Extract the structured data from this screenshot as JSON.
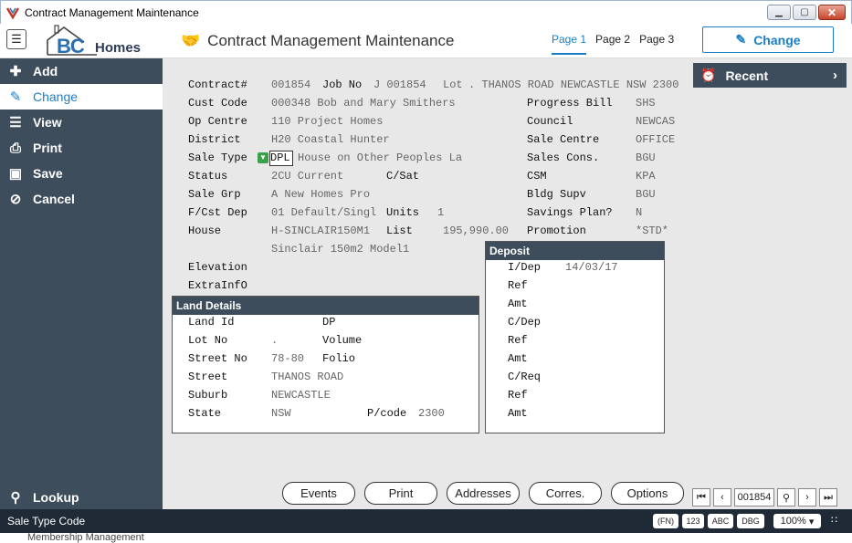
{
  "window": {
    "title": "Contract Management Maintenance"
  },
  "header": {
    "app_title": "Contract Management Maintenance",
    "logo_bc": "BC",
    "logo_homes": "Homes",
    "tabs": [
      "Page 1",
      "Page 2",
      "Page 3"
    ],
    "change_label": "Change"
  },
  "sidebar": {
    "items": [
      {
        "label": "Add",
        "icon": "plus-icon"
      },
      {
        "label": "Change",
        "icon": "pencil-icon"
      },
      {
        "label": "View",
        "icon": "list-icon"
      },
      {
        "label": "Print",
        "icon": "printer-icon"
      },
      {
        "label": "Save",
        "icon": "save-icon"
      },
      {
        "label": "Cancel",
        "icon": "cancel-icon"
      }
    ],
    "lookup_label": "Lookup"
  },
  "recent": {
    "label": "Recent"
  },
  "form": {
    "contract_label": "Contract#",
    "contract": "001854",
    "jobno_label": "Job No",
    "jobno": "J 001854",
    "lot_label": "Lot",
    "lot_addr": ". THANOS ROAD NEWCASTLE NSW 2300",
    "custcode_label": "Cust Code",
    "custcode": "000348 Bob and Mary Smithers",
    "opcentre_label": "Op Centre",
    "opcentre": "110 Project Homes",
    "district_label": "District",
    "district": "H20 Coastal Hunter",
    "saletype_label": "Sale Type",
    "saletype_code": "DPL",
    "saletype_desc": "House on Other Peoples La",
    "status_label": "Status",
    "status": "2CU Current",
    "csat_label": "C/Sat",
    "salegrp_label": "Sale Grp",
    "salegrp": "A   New Homes Pro",
    "fcstdep_label": "F/Cst Dep",
    "fcstdep": "01  Default/Singl",
    "units_label": "Units",
    "units": "1",
    "house_label": "House",
    "house": "H-SINCLAIR150M1",
    "list_label": "List",
    "list": "195,990.00",
    "house_desc": "Sinclair 150m2 Model1",
    "elevation_label": "Elevation",
    "extrainfo_label": "ExtraInfO",
    "progressbill_label": "Progress Bill",
    "progressbill": "SHS",
    "council_label": "Council",
    "council": "NEWCAS",
    "salecentre_label": "Sale Centre",
    "salecentre": "OFFICE",
    "salescons_label": "Sales Cons.",
    "salescons": "BGU",
    "csm_label": "CSM",
    "csm": "KPA",
    "bldgsupv_label": "Bldg Supv",
    "bldgsupv": "BGU",
    "savings_label": "Savings Plan?",
    "savings": "N",
    "promotion_label": "Promotion",
    "promotion": "*STD*"
  },
  "land": {
    "title": "Land Details",
    "landid_label": "Land Id",
    "dp_label": "DP",
    "lotno_label": "Lot No",
    "lotno": ".",
    "volume_label": "Volume",
    "streetno_label": "Street No",
    "streetno": "78-80",
    "folio_label": "Folio",
    "street_label": "Street",
    "street": "THANOS ROAD",
    "suburb_label": "Suburb",
    "suburb": "NEWCASTLE",
    "state_label": "State",
    "state": "NSW",
    "pcode_label": "P/code",
    "pcode": "2300"
  },
  "deposit": {
    "title": "Deposit",
    "idep_label": "I/Dep",
    "idep": "14/03/17",
    "ref1_label": "Ref",
    "amt1_label": "Amt",
    "cdep_label": "C/Dep",
    "ref2_label": "Ref",
    "amt2_label": "Amt",
    "creq_label": "C/Req",
    "ref3_label": "Ref",
    "amt3_label": "Amt"
  },
  "bottom": {
    "buttons": [
      "Events",
      "Print",
      "Addresses",
      "Corres.",
      "Options"
    ],
    "record": "001854"
  },
  "status": {
    "text": "Sale Type Code",
    "fn": "(FN)",
    "n123": "123",
    "abc": "ABC",
    "dbg": "DBG",
    "zoom": "100%"
  },
  "below_text": "Membership Management"
}
